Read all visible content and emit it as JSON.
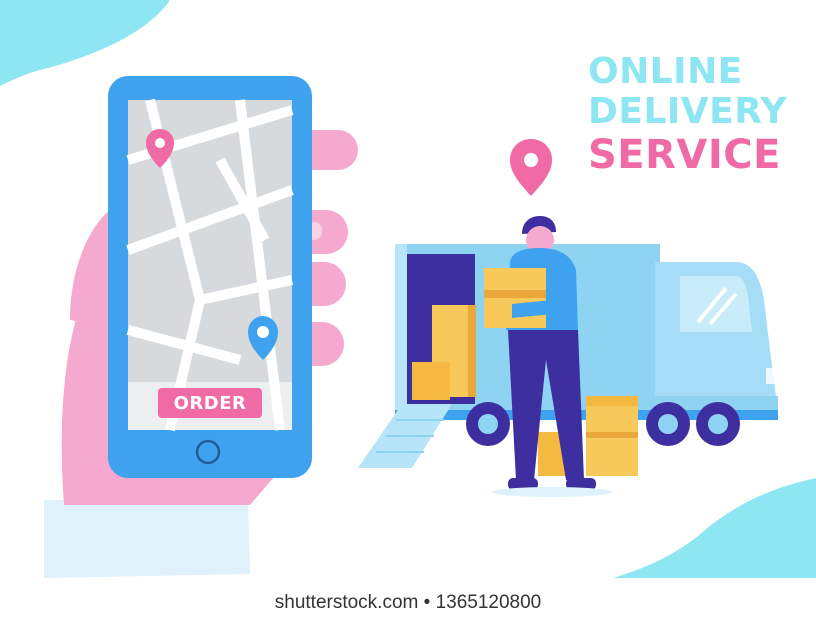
{
  "headline": {
    "line1": "ONLINE",
    "line2": "DELIVERY",
    "line3": "SERVICE"
  },
  "phone": {
    "order_label": "ORDER"
  },
  "watermark": {
    "text": "shutterstock.com • 1365120800"
  },
  "icons": [
    "map-pin-icon",
    "home-button-icon",
    "delivery-truck-illustration",
    "courier-illustration",
    "hand-illustration",
    "box-icon"
  ],
  "colors": {
    "light_blue": "#8ee6f2",
    "pink": "#f06aa6",
    "phone_blue": "#3fa2ee",
    "truck_blue": "#8fd3f3",
    "courier_navy": "#3e2fa0",
    "box_yellow": "#f7c85a"
  }
}
